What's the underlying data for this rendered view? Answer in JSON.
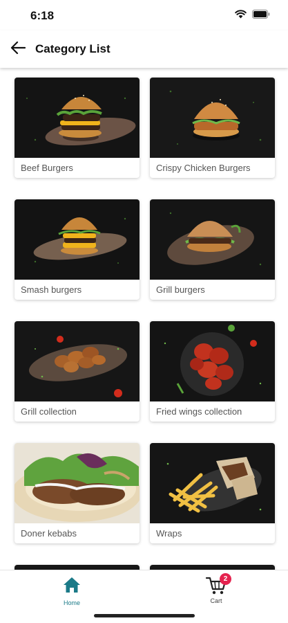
{
  "status_bar": {
    "time": "6:18"
  },
  "app_bar": {
    "title": "Category List"
  },
  "categories": [
    {
      "label": "Beef Burgers"
    },
    {
      "label": "Crispy Chicken Burgers"
    },
    {
      "label": "Smash burgers"
    },
    {
      "label": "Grill burgers"
    },
    {
      "label": "Grill collection"
    },
    {
      "label": "Fried wings collection"
    },
    {
      "label": "Doner kebabs"
    },
    {
      "label": "Wraps"
    }
  ],
  "bottom_nav": {
    "home_label": "Home",
    "cart_label": "Cart",
    "cart_count": "2",
    "active": "Home"
  },
  "colors": {
    "accent": "#1b7a88",
    "badge": "#e5234f"
  }
}
